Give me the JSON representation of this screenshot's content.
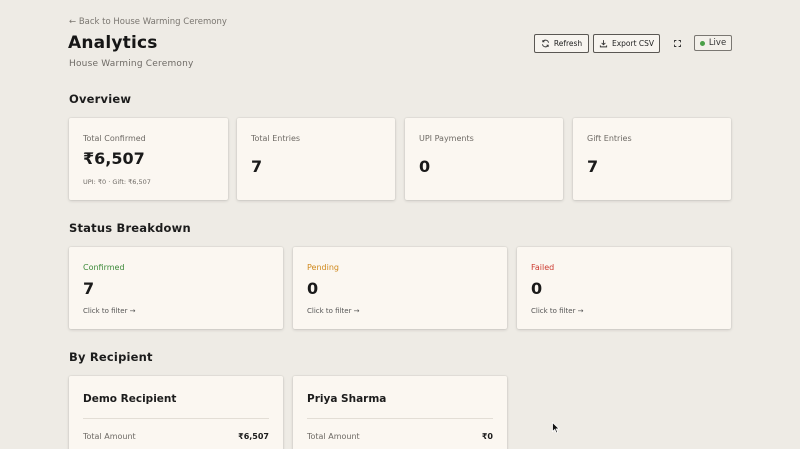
{
  "header": {
    "back_link": "← Back to House Warming Ceremony",
    "title": "Analytics",
    "subtitle": "House Warming Ceremony"
  },
  "toolbar": {
    "refresh_label": "Refresh",
    "export_label": "Export CSV",
    "live_label": "Live",
    "icons": [
      "refresh-icon",
      "download-icon",
      "expand-icon"
    ],
    "live_color": "#4aa048"
  },
  "overview": {
    "title": "Overview",
    "cards": [
      {
        "label": "Total Confirmed",
        "value": "₹6,507",
        "sub": "UPI: ₹0 · Gift: ₹6,507"
      },
      {
        "label": "Total Entries",
        "value": "7"
      },
      {
        "label": "UPI Payments",
        "value": "0"
      },
      {
        "label": "Gift Entries",
        "value": "7"
      }
    ]
  },
  "status": {
    "title": "Status Breakdown",
    "cards": [
      {
        "label": "Confirmed",
        "value": "7",
        "hint": "Click to filter →",
        "color": "#3d8a3a"
      },
      {
        "label": "Pending",
        "value": "0",
        "hint": "Click to filter →",
        "color": "#d08a1e"
      },
      {
        "label": "Failed",
        "value": "0",
        "hint": "Click to filter →",
        "color": "#cc3a2f"
      }
    ]
  },
  "recipients": {
    "title": "By Recipient",
    "cards": [
      {
        "name": "Demo Recipient",
        "row_label": "Total Amount",
        "row_value": "₹6,507"
      },
      {
        "name": "Priya Sharma",
        "row_label": "Total Amount",
        "row_value": "₹0"
      }
    ]
  }
}
